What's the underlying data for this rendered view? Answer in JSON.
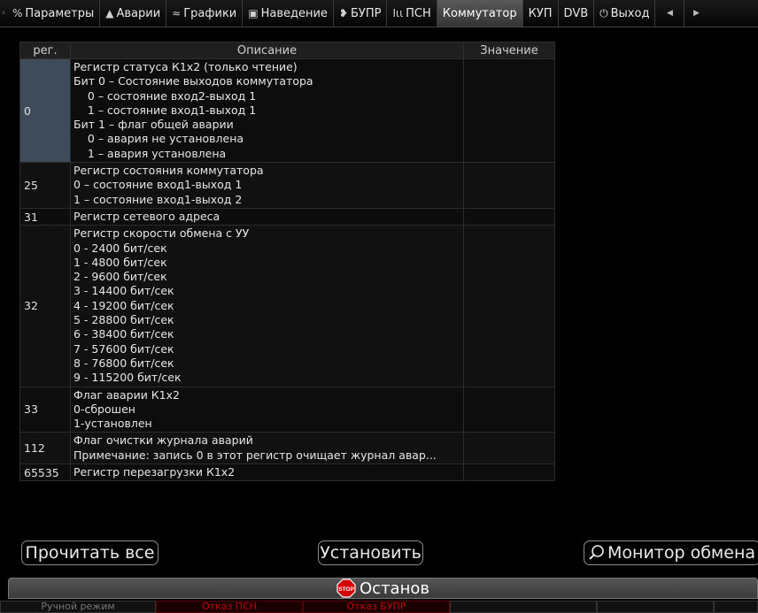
{
  "tabs": [
    {
      "label": "Параметры",
      "icon": "%",
      "icon_name": "percent-icon",
      "name": "tab-parameters",
      "active": false
    },
    {
      "label": "Аварии",
      "icon": "▲",
      "icon_name": "warning-icon",
      "name": "tab-alarms",
      "active": false
    },
    {
      "label": "Графики",
      "icon": "≈",
      "icon_name": "chart-icon",
      "name": "tab-charts",
      "active": false
    },
    {
      "label": "Наведение",
      "icon": "▣",
      "icon_name": "target-icon",
      "name": "tab-guidance",
      "active": false
    },
    {
      "label": "БУПР",
      "icon": "❥",
      "icon_name": "antenna-icon",
      "name": "tab-bupr",
      "active": false
    },
    {
      "label": "ПСН",
      "icon": "Ιιι",
      "icon_name": "signal-icon",
      "name": "tab-psn",
      "active": false
    },
    {
      "label": "Коммутатор",
      "icon": "",
      "icon_name": "",
      "name": "tab-switch",
      "active": true
    },
    {
      "label": "КУП",
      "icon": "",
      "icon_name": "",
      "name": "tab-kup",
      "active": false
    },
    {
      "label": "DVB",
      "icon": "",
      "icon_name": "",
      "name": "tab-dvb",
      "active": false
    },
    {
      "label": "Выход",
      "icon": "⏻",
      "icon_name": "power-icon",
      "name": "tab-exit",
      "active": false
    }
  ],
  "table": {
    "headers": {
      "reg": "рег.",
      "desc": "Описание",
      "value": "Значение"
    },
    "rows": [
      {
        "reg": "0",
        "value": "",
        "selected": true,
        "lines": [
          "Регистр статуса К1х2 (только чтение)",
          "Бит 0 – Состояние выходов коммутатора",
          "    0 – состояние вход2-выход 1",
          "    1 – состояние вход1-выход 1",
          "Бит 1 – флаг общей аварии",
          "    0 – авария не установлена",
          "    1 – авария установлена"
        ]
      },
      {
        "reg": "25",
        "value": "",
        "selected": false,
        "lines": [
          "Регистр состояния коммутатора",
          "0 – состояние вход1-выход 1",
          "1 – состояние вход1-выход 2"
        ]
      },
      {
        "reg": "31",
        "value": "",
        "selected": false,
        "lines": [
          "Регистр сетевого адреса"
        ]
      },
      {
        "reg": "32",
        "value": "",
        "selected": false,
        "lines": [
          "Регистр скорости обмена с УУ",
          "0 - 2400 бит/сек",
          "1 - 4800 бит/сек",
          "2 - 9600 бит/сек",
          "3 - 14400 бит/сек",
          "4 - 19200 бит/сек",
          "5 - 28800 бит/сек",
          "6 - 38400 бит/сек",
          "7 - 57600 бит/сек",
          "8 - 76800 бит/сек",
          "9 - 115200 бит/сек"
        ]
      },
      {
        "reg": "33",
        "value": "",
        "selected": false,
        "lines": [
          "Флаг аварии К1х2",
          "0-сброшен",
          "1-установлен"
        ]
      },
      {
        "reg": "112",
        "value": "",
        "selected": false,
        "lines": [
          "Флаг очистки журнала аварий",
          "Примечание: запись 0 в этот регистр очищает журнал авар..."
        ]
      },
      {
        "reg": "65535",
        "value": "",
        "selected": false,
        "lines": [
          "Регистр перезагрузки К1х2"
        ]
      }
    ]
  },
  "buttons": {
    "read_all": "Прочитать все",
    "set": "Установить",
    "monitor": "Монитор обмена"
  },
  "stop": {
    "label": "Останов",
    "icon_text": "STOP"
  },
  "status": [
    {
      "text": "Ручной режим",
      "style": "gray"
    },
    {
      "text": "Отказ ПСН",
      "style": "red"
    },
    {
      "text": "Отказ БУПР",
      "style": "red"
    },
    {
      "text": "",
      "style": "gray"
    },
    {
      "text": "",
      "style": "gray"
    },
    {
      "text": "",
      "style": "gray"
    }
  ],
  "colors": {
    "selected_cell": "#3d4b5a",
    "alarm_text": "#c10000",
    "stop_red": "#d40000"
  }
}
